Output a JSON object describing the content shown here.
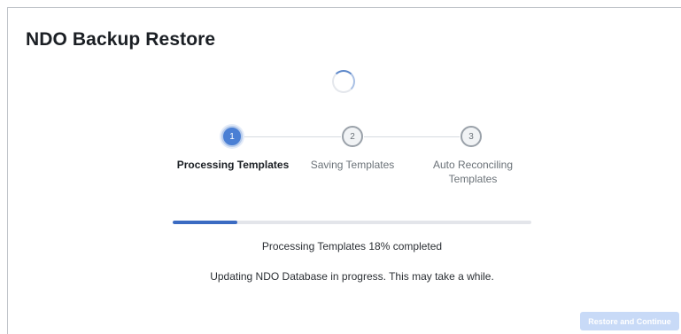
{
  "dialog": {
    "title": "NDO Backup Restore"
  },
  "steps": [
    {
      "number": "1",
      "label": "Processing Templates",
      "state": "active"
    },
    {
      "number": "2",
      "label": "Saving Templates",
      "state": "pending"
    },
    {
      "number": "3",
      "label": "Auto Reconciling Templates",
      "state": "pending"
    }
  ],
  "progress": {
    "percent": 18,
    "text": "Processing Templates 18% completed",
    "status": "Updating NDO Database in progress. This may take a while."
  },
  "actions": {
    "restore_label": "Restore and Continue"
  },
  "colors": {
    "accent": "#4a7fd4",
    "progress_fill": "#3b6bc2",
    "disabled_button": "#c8daf7"
  }
}
